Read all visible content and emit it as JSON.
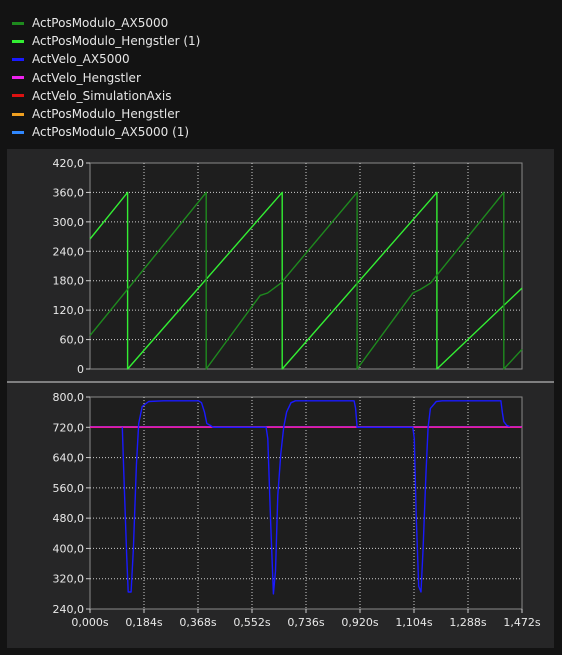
{
  "legend": {
    "items": [
      {
        "label": "ActPosModulo_AX5000",
        "color": "#1e8a1e"
      },
      {
        "label": "ActPosModulo_Hengstler (1)",
        "color": "#33ee33"
      },
      {
        "label": "ActVelo_AX5000",
        "color": "#1a1aff"
      },
      {
        "label": "ActVelo_Hengstler",
        "color": "#ee22ee"
      },
      {
        "label": "ActVelo_SimulationAxis",
        "color": "#dd1111"
      },
      {
        "label": "ActPosModulo_Hengstler",
        "color": "#f0a020"
      },
      {
        "label": "ActPosModulo_AX5000 (1)",
        "color": "#3088ff"
      }
    ]
  },
  "chart_data": [
    {
      "type": "line",
      "ylim": [
        0,
        420
      ],
      "xlim": [
        0,
        1.472
      ],
      "y_ticks": [
        "0",
        "60,0",
        "120,0",
        "180,0",
        "240,0",
        "300,0",
        "360,0",
        "420,0"
      ],
      "grid": true,
      "series": [
        {
          "name": "ActPosModulo_Hengstler (1)",
          "color": "#33ee33",
          "points": [
            [
              0,
              265
            ],
            [
              0.128,
              360
            ],
            [
              0.128,
              0
            ],
            [
              0.655,
              360
            ],
            [
              0.655,
              0
            ],
            [
              1.182,
              360
            ],
            [
              1.182,
              0
            ],
            [
              1.472,
              165
            ]
          ]
        },
        {
          "name": "ActPosModulo_AX5000",
          "color": "#1e8a1e",
          "points": [
            [
              0,
              68
            ],
            [
              0.396,
              360
            ],
            [
              0.396,
              0
            ],
            [
              0.58,
              150
            ],
            [
              0.605,
              155
            ],
            [
              0.65,
              175
            ],
            [
              0.91,
              360
            ],
            [
              0.91,
              0
            ],
            [
              1.1,
              155
            ],
            [
              1.125,
              162
            ],
            [
              1.16,
              175
            ],
            [
              1.41,
              360
            ],
            [
              1.41,
              0
            ],
            [
              1.472,
              40
            ]
          ]
        }
      ]
    },
    {
      "type": "line",
      "ylim": [
        240,
        800
      ],
      "xlim": [
        0,
        1.472
      ],
      "y_ticks": [
        "240,0",
        "320,0",
        "400,0",
        "480,0",
        "560,0",
        "640,0",
        "720,0",
        "800,0"
      ],
      "x_ticks": [
        "0,000s",
        "0,184s",
        "0,368s",
        "0,552s",
        "0,736s",
        "0,920s",
        "1,104s",
        "1,288s",
        "1,472s"
      ],
      "grid": true,
      "series": [
        {
          "name": "ActVelo_SimulationAxis",
          "color": "#dd1111",
          "points": [
            [
              0,
              720
            ],
            [
              1.472,
              720
            ]
          ]
        },
        {
          "name": "ActVelo_Hengstler",
          "color": "#ee22ee",
          "points": [
            [
              0,
              721
            ],
            [
              1.472,
              721
            ]
          ]
        },
        {
          "name": "ActVelo_AX5000",
          "color": "#1a1aff",
          "points": [
            [
              0.11,
              720
            ],
            [
              0.115,
              600
            ],
            [
              0.125,
              380
            ],
            [
              0.13,
              285
            ],
            [
              0.14,
              285
            ],
            [
              0.148,
              400
            ],
            [
              0.158,
              620
            ],
            [
              0.166,
              730
            ],
            [
              0.178,
              775
            ],
            [
              0.2,
              788
            ],
            [
              0.25,
              790
            ],
            [
              0.37,
              790
            ],
            [
              0.38,
              785
            ],
            [
              0.39,
              760
            ],
            [
              0.398,
              730
            ],
            [
              0.41,
              725
            ],
            [
              0.42,
              720
            ],
            [
              0.6,
              720
            ],
            [
              0.606,
              690
            ],
            [
              0.615,
              480
            ],
            [
              0.625,
              280
            ],
            [
              0.632,
              340
            ],
            [
              0.64,
              540
            ],
            [
              0.65,
              650
            ],
            [
              0.66,
              720
            ],
            [
              0.67,
              760
            ],
            [
              0.685,
              785
            ],
            [
              0.7,
              790
            ],
            [
              0.9,
              790
            ],
            [
              0.905,
              770
            ],
            [
              0.91,
              720
            ],
            [
              1.1,
              720
            ],
            [
              1.105,
              690
            ],
            [
              1.112,
              480
            ],
            [
              1.12,
              300
            ],
            [
              1.128,
              285
            ],
            [
              1.135,
              400
            ],
            [
              1.145,
              600
            ],
            [
              1.152,
              720
            ],
            [
              1.16,
              770
            ],
            [
              1.18,
              788
            ],
            [
              1.2,
              790
            ],
            [
              1.4,
              790
            ],
            [
              1.405,
              760
            ],
            [
              1.41,
              735
            ],
            [
              1.42,
              725
            ],
            [
              1.43,
              722
            ]
          ]
        }
      ]
    }
  ]
}
